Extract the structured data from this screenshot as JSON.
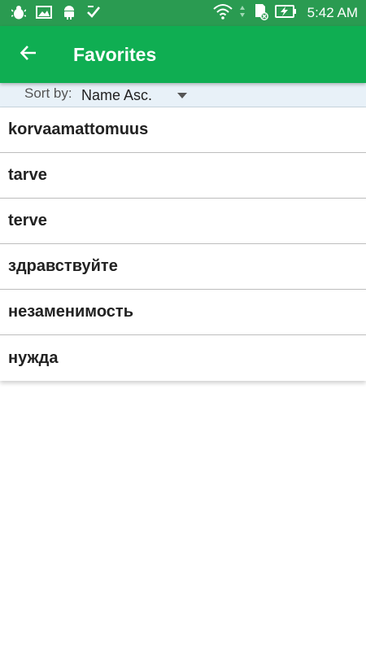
{
  "status_bar": {
    "time": "5:42 AM",
    "left_icons": [
      "bug-icon",
      "image-icon",
      "android-icon",
      "check-icon"
    ],
    "right_icons": [
      "wifi-icon",
      "data-arrows-icon",
      "sd-card-icon",
      "battery-charging-icon"
    ],
    "color": "#2a9b51"
  },
  "app_bar": {
    "title": "Favorites",
    "back_icon": "arrow-back-icon",
    "color": "#0fae52"
  },
  "sort": {
    "label": "Sort by:",
    "value": "Name Asc."
  },
  "favorites": [
    {
      "word": "korvaamattomuus"
    },
    {
      "word": "tarve"
    },
    {
      "word": "terve"
    },
    {
      "word": "здравствуйте"
    },
    {
      "word": "незаменимость"
    },
    {
      "word": "нужда"
    }
  ]
}
